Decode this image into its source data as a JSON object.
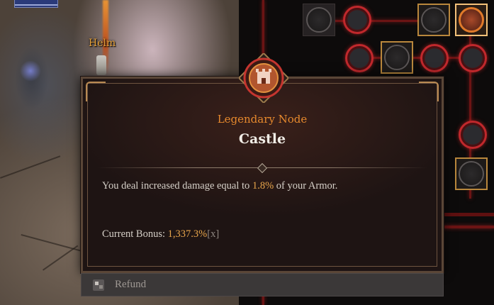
{
  "world": {
    "drop_label": "Helm"
  },
  "tooltip": {
    "node_type": "Legendary Node",
    "node_name": "Castle",
    "description_before": "You deal increased damage equal to ",
    "description_value": "1.8%",
    "description_after": " of your Armor.",
    "bonus_label": "Current Bonus: ",
    "bonus_value": "1,337.3%",
    "bonus_suffix": "[x]"
  },
  "actions": {
    "refund_label": "Refund"
  },
  "icons": {
    "crest": "castle-crest-icon",
    "refund": "controller-button-icon"
  },
  "colors": {
    "accent_orange": "#e6892d",
    "highlight": "#e9a64c",
    "red_node": "#c0282c"
  }
}
